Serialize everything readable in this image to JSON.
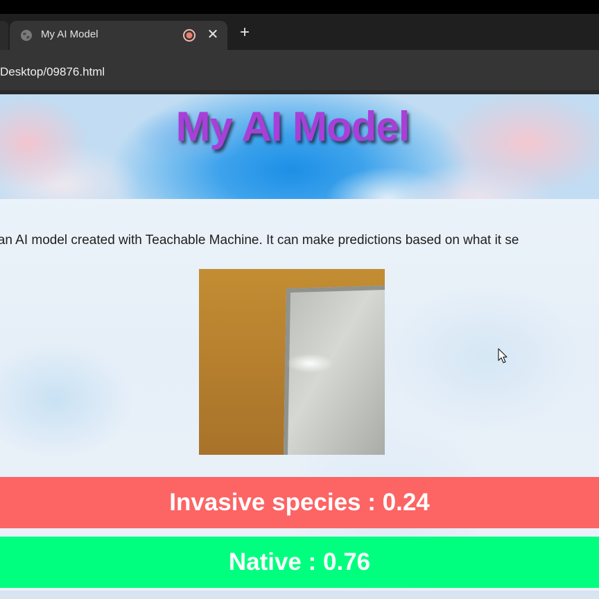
{
  "browser": {
    "tab": {
      "title": "My AI Model"
    },
    "address_bar": {
      "url_fragment": "Desktop/09876.html"
    },
    "icons": {
      "favicon": "globe-icon",
      "record": "recording-indicator-icon",
      "close": "close-icon",
      "new_tab": "plus-icon"
    },
    "close_glyph": "✕",
    "new_tab_glyph": "+"
  },
  "page": {
    "title": "My AI Model",
    "description": "s an AI model created with Teachable Machine. It can make predictions based on what it se",
    "webcam": {
      "icon": "webcam-preview"
    },
    "predictions": [
      {
        "label": "Invasive species",
        "separator": " : ",
        "value": "0.24",
        "color": "#fd6464"
      },
      {
        "label": "Native",
        "separator": " : ",
        "value": "0.76",
        "color": "#00ff7f"
      }
    ]
  },
  "colors": {
    "title": "#a83fd8",
    "chrome_dark": "#1f1f1f",
    "tab_active": "#353535"
  }
}
